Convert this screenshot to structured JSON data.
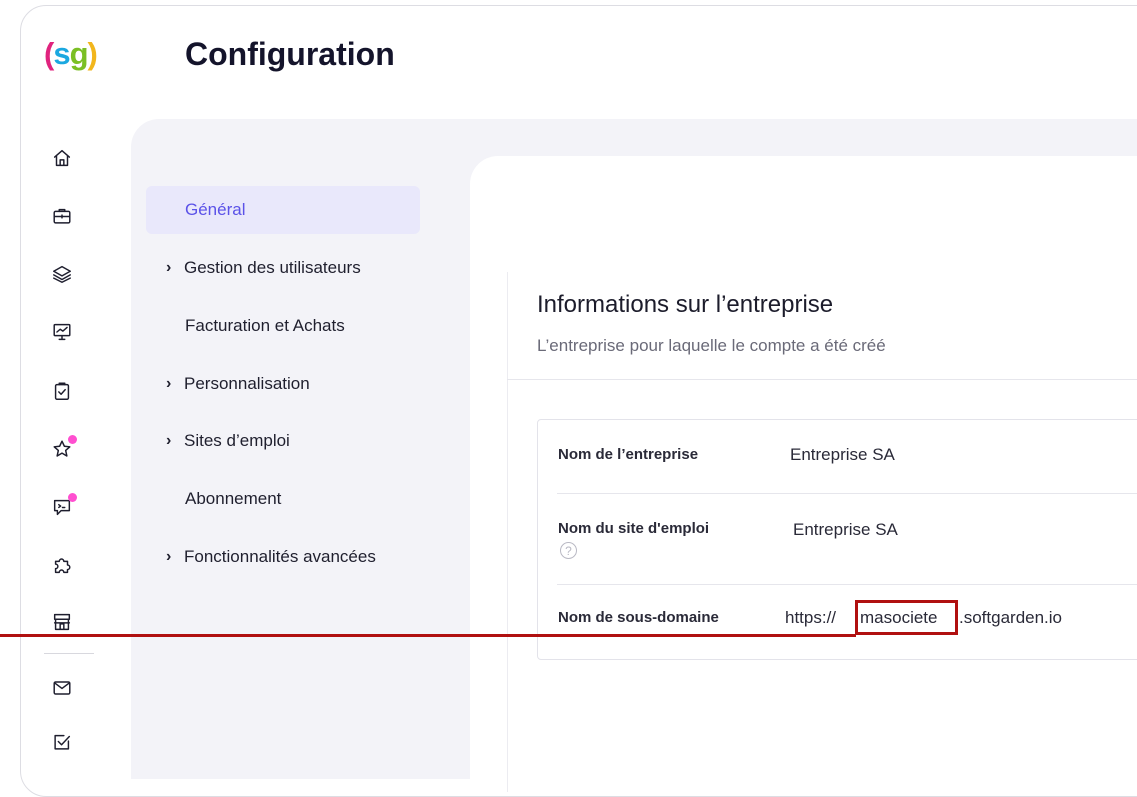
{
  "header": {
    "logo_text": "(sg)",
    "title": "Configuration"
  },
  "rail": {
    "icons": [
      "home-icon",
      "briefcase-icon",
      "layers-icon",
      "presentation-chart-icon",
      "clipboard-check-icon",
      "star-icon",
      "chat-icon",
      "puzzle-icon",
      "store-icon",
      "mail-icon",
      "checkbox-icon"
    ],
    "notification_color": "#ff4fd0"
  },
  "nav": {
    "items": [
      {
        "label": "Général",
        "expandable": false,
        "active": true
      },
      {
        "label": "Gestion des utilisateurs",
        "expandable": true,
        "active": false
      },
      {
        "label": "Facturation et Achats",
        "expandable": false,
        "active": false
      },
      {
        "label": "Personnalisation",
        "expandable": true,
        "active": false
      },
      {
        "label": "Sites d’emploi",
        "expandable": true,
        "active": false
      },
      {
        "label": "Abonnement",
        "expandable": false,
        "active": false
      },
      {
        "label": "Fonctionnalités avancées",
        "expandable": true,
        "active": false
      }
    ],
    "active_color": "#5b52e8"
  },
  "section": {
    "title": "Informations sur l’entreprise",
    "subtitle": "L’entreprise pour laquelle le compte a été créé"
  },
  "company": {
    "rows": [
      {
        "label": "Nom de l’entreprise",
        "value": "Entreprise SA"
      },
      {
        "label": "Nom du site d'emploi",
        "value": "Entreprise SA",
        "help": "?"
      },
      {
        "label": "Nom de sous-domaine",
        "prefix": "https://",
        "subdomain": "masociete",
        "suffix": ".softgarden.io"
      }
    ]
  },
  "annotation": {
    "color": "#b01010"
  }
}
